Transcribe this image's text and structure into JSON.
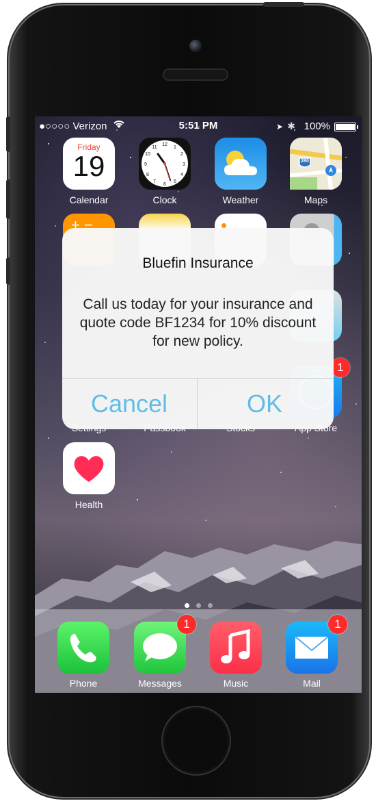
{
  "status_bar": {
    "carrier": "●○○○○ Verizon",
    "time": "5:51 PM",
    "battery": "100%"
  },
  "apps": {
    "calendar": {
      "label": "Calendar",
      "day": "Friday",
      "date": "19"
    },
    "clock": {
      "label": "Clock"
    },
    "weather": {
      "label": "Weather"
    },
    "maps": {
      "label": "Maps",
      "shield": "280"
    },
    "settings": {
      "label": "Settings"
    },
    "passbook": {
      "label": "Passbook"
    },
    "stocks": {
      "label": "Stocks"
    },
    "app_store": {
      "label": "App Store",
      "badge": "1"
    },
    "health": {
      "label": "Health"
    }
  },
  "dock": {
    "phone": {
      "label": "Phone"
    },
    "messages": {
      "label": "Messages",
      "badge": "1"
    },
    "music": {
      "label": "Music"
    },
    "mail": {
      "label": "Mail",
      "badge": "1"
    }
  },
  "page_dots": {
    "count": 3,
    "active": 1
  },
  "alert": {
    "title": "Bluefin Insurance",
    "message": "Call us today for your insurance and quote code BF1234 for 10% discount for new policy.",
    "cancel_label": "Cancel",
    "ok_label": "OK"
  },
  "colors": {
    "alert_button": "#5fbde6",
    "badge": "#ff2a2a"
  }
}
